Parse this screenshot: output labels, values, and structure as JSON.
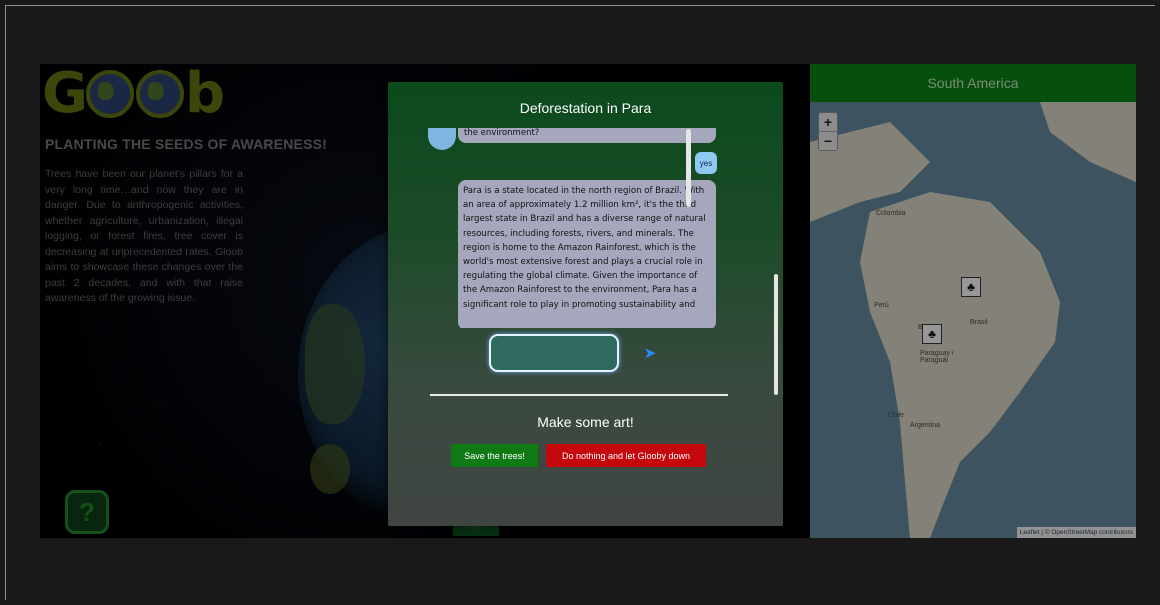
{
  "app": {
    "logo_left": "G",
    "logo_right": "b",
    "tagline": "PLANTING THE SEEDS OF AWARENESS!",
    "intro": "Trees have been our planet's pillars for a very long time…and now they are in danger. Due to anthropogenic activities, whether agriculture, urbanization, illegal logging, or forest fires, tree cover is decreasing at unprecedented rates. Gloob aims to showcase these changes over the past 2 decades, and with that raise awareness of the growing issue.",
    "help_label": "?",
    "hidden_button_label": "over"
  },
  "map": {
    "header": "South America",
    "zoom_in": "+",
    "zoom_out": "−",
    "labels": {
      "colombia": "Colombia",
      "peru": "Perú",
      "brasil": "Brasil",
      "paraguay": "Paraguay / Paraguái",
      "chile": "Chile",
      "argentina": "Argentina",
      "bolivia": "B"
    },
    "attribution": "Leaflet | © OpenStreetMap contributors"
  },
  "modal": {
    "title": "Deforestation in Para",
    "bot_message_top": "the environment?",
    "user_message": "yes",
    "bot_message": "Para is a state located in the north region of Brazil. With an area of approximately 1.2 million km², it's the third largest state in Brazil and has a diverse range of natural resources, including forests, rivers, and minerals. The region is home to the Amazon Rainforest, which is the world's most extensive forest and plays a crucial role in regulating the global climate. Given the importance of the Amazon Rainforest to the environment, Para has a significant role to play in promoting sustainability and",
    "input_value": "",
    "send_icon": "paper-plane-icon",
    "art_title": "Make some art!",
    "save_button": "Save the trees!",
    "nothing_button": "Do nothing and let Glooby down"
  },
  "colors": {
    "page_bg": "#272727",
    "modal_green": "#0b4a1d",
    "save_green": "#0f7a13",
    "danger_red": "#c4080c",
    "map_header_green": "#0c7a14",
    "user_bubble": "#8fc8f1",
    "bot_bubble": "#a5a8bc"
  }
}
